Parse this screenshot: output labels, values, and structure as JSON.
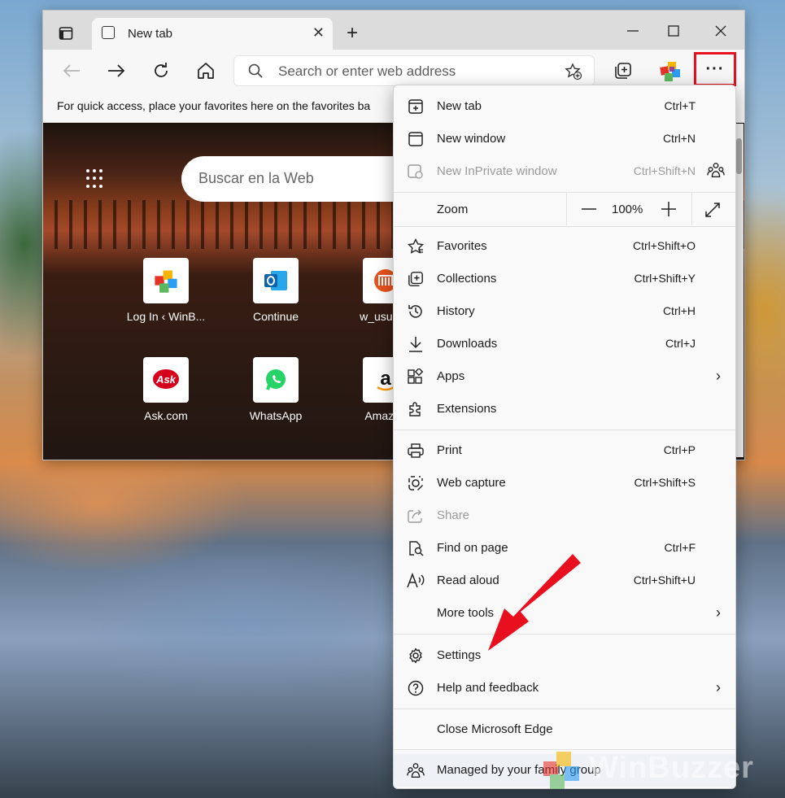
{
  "window": {
    "tab_title": "New tab",
    "address_placeholder": "Search or enter web address",
    "favorites_bar_text": "For quick access, place your favorites here on the favorites ba"
  },
  "newtab": {
    "search_placeholder": "Buscar en la Web",
    "tiles": [
      {
        "label": "Log In ‹ WinB...",
        "icon": "winbuzzer-icon"
      },
      {
        "label": "Continue",
        "icon": "outlook-icon"
      },
      {
        "label": "w_usuario",
        "icon": "w-usuario-icon"
      },
      {
        "label": "Ask.com",
        "icon": "ask-icon"
      },
      {
        "label": "WhatsApp",
        "icon": "whatsapp-icon"
      },
      {
        "label": "Amazon",
        "icon": "amazon-icon"
      }
    ]
  },
  "menu": {
    "new_tab": {
      "label": "New tab",
      "shortcut": "Ctrl+T"
    },
    "new_window": {
      "label": "New window",
      "shortcut": "Ctrl+N"
    },
    "new_inprivate": {
      "label": "New InPrivate window",
      "shortcut": "Ctrl+Shift+N"
    },
    "zoom": {
      "label": "Zoom",
      "value": "100%"
    },
    "favorites": {
      "label": "Favorites",
      "shortcut": "Ctrl+Shift+O"
    },
    "collections": {
      "label": "Collections",
      "shortcut": "Ctrl+Shift+Y"
    },
    "history": {
      "label": "History",
      "shortcut": "Ctrl+H"
    },
    "downloads": {
      "label": "Downloads",
      "shortcut": "Ctrl+J"
    },
    "apps": {
      "label": "Apps"
    },
    "extensions": {
      "label": "Extensions"
    },
    "print": {
      "label": "Print",
      "shortcut": "Ctrl+P"
    },
    "web_capture": {
      "label": "Web capture",
      "shortcut": "Ctrl+Shift+S"
    },
    "share": {
      "label": "Share"
    },
    "find": {
      "label": "Find on page",
      "shortcut": "Ctrl+F"
    },
    "read_aloud": {
      "label": "Read aloud",
      "shortcut": "Ctrl+Shift+U"
    },
    "more_tools": {
      "label": "More tools"
    },
    "settings": {
      "label": "Settings"
    },
    "help": {
      "label": "Help and feedback"
    },
    "close_edge": {
      "label": "Close Microsoft Edge"
    },
    "managed": {
      "label": "Managed by your family group"
    }
  },
  "watermark": {
    "text": "WinBuzzer"
  },
  "colors": {
    "highlight": "#e8101e",
    "arrow": "#e8101e",
    "accent": "#0067c0"
  }
}
